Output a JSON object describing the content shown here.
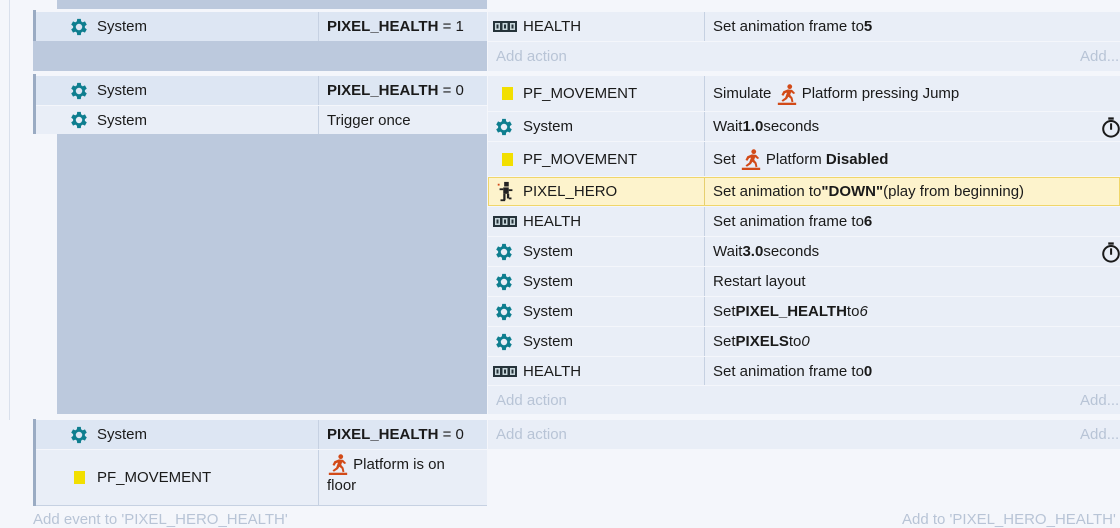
{
  "colors": {
    "gear": "#0e7e8f",
    "platform_icon": "#d24a18",
    "pf_square": "#f2df00",
    "highlight": "#fdf3cc"
  },
  "common": {
    "system": "System",
    "add_action": "Add action",
    "add_action_short": "Add...",
    "pf_movement": "PF_MOVEMENT",
    "health": "HEALTH",
    "pixel_hero": "PIXEL_HERO"
  },
  "event1": {
    "condition": {
      "object": "System",
      "var": "PIXEL_HEALTH",
      "op": "= 1"
    },
    "actions": [
      {
        "object": "HEALTH",
        "pre": "Set animation frame to ",
        "value": "5"
      }
    ]
  },
  "event2": {
    "conditions": [
      {
        "object": "System",
        "var": "PIXEL_HEALTH",
        "op": "= 0"
      },
      {
        "object": "System",
        "text": "Trigger once"
      }
    ],
    "actions": [
      {
        "object": "PF_MOVEMENT",
        "pre": "Simulate",
        "mid": "Platform pressing Jump"
      },
      {
        "object": "System",
        "pre": "Wait ",
        "value": "1.0",
        "post": " seconds"
      },
      {
        "object": "PF_MOVEMENT",
        "pre": "Set",
        "mid": "Platform",
        "value": "Disabled"
      },
      {
        "object": "PIXEL_HERO",
        "pre": "Set animation to ",
        "value": "\"DOWN\"",
        "post": " (play from beginning)"
      },
      {
        "object": "HEALTH",
        "pre": "Set animation frame to ",
        "value": "6"
      },
      {
        "object": "System",
        "pre": "Wait ",
        "value": "3.0",
        "post": " seconds"
      },
      {
        "object": "System",
        "pre": "Restart layout"
      },
      {
        "object": "System",
        "pre": "Set ",
        "value": "PIXEL_HEALTH",
        "mid": " to ",
        "ital": "6"
      },
      {
        "object": "System",
        "pre": "Set ",
        "value": "PIXELS",
        "mid": " to ",
        "ital": "0"
      },
      {
        "object": "HEALTH",
        "pre": "Set animation frame to ",
        "value": "0"
      }
    ]
  },
  "event3": {
    "conditions": [
      {
        "object": "System",
        "var": "PIXEL_HEALTH",
        "op": "= 0"
      },
      {
        "object": "PF_MOVEMENT",
        "text1": "Platform is on",
        "text2": "floor"
      }
    ]
  },
  "footer": {
    "add_event": "Add event to 'PIXEL_HERO_HEALTH'",
    "add_to": "Add to 'PIXEL_HERO_HEALTH'"
  }
}
